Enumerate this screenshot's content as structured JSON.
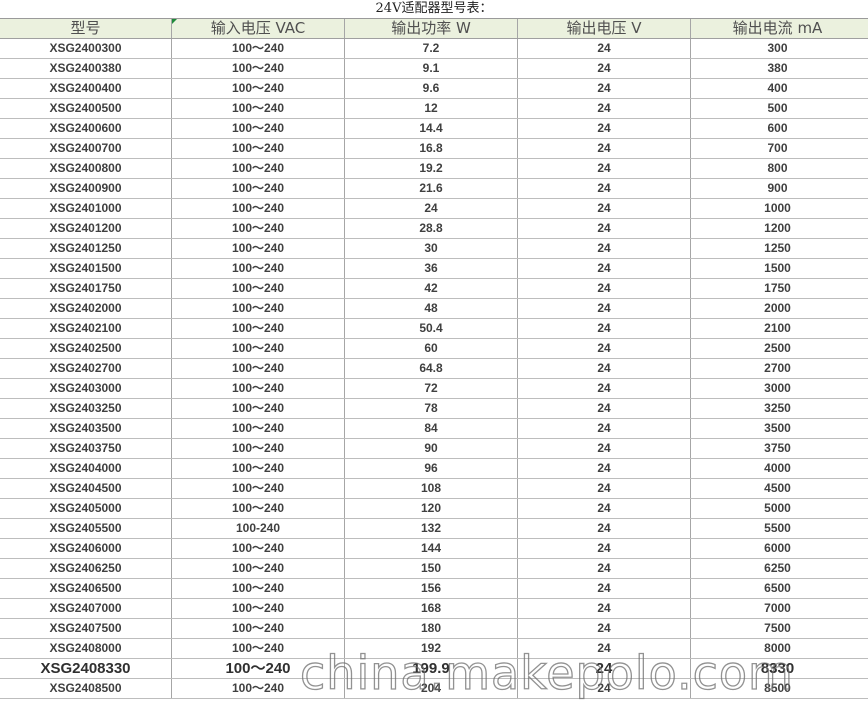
{
  "title": "24V适配器型号表：",
  "headers": [
    "型号",
    "输入电压 VAC",
    "输出功率 W",
    "输出电压 V",
    "输出电流 mA"
  ],
  "rows": [
    [
      "XSG2400300",
      "100～240",
      "7.2",
      "24",
      "300"
    ],
    [
      "XSG2400380",
      "100～240",
      "9.1",
      "24",
      "380"
    ],
    [
      "XSG2400400",
      "100～240",
      "9.6",
      "24",
      "400"
    ],
    [
      "XSG2400500",
      "100～240",
      "12",
      "24",
      "500"
    ],
    [
      "XSG2400600",
      "100～240",
      "14.4",
      "24",
      "600"
    ],
    [
      "XSG2400700",
      "100～240",
      "16.8",
      "24",
      "700"
    ],
    [
      "XSG2400800",
      "100～240",
      "19.2",
      "24",
      "800"
    ],
    [
      "XSG2400900",
      "100～240",
      "21.6",
      "24",
      "900"
    ],
    [
      "XSG2401000",
      "100～240",
      "24",
      "24",
      "1000"
    ],
    [
      "XSG2401200",
      "100～240",
      "28.8",
      "24",
      "1200"
    ],
    [
      "XSG2401250",
      "100～240",
      "30",
      "24",
      "1250"
    ],
    [
      "XSG2401500",
      "100～240",
      "36",
      "24",
      "1500"
    ],
    [
      "XSG2401750",
      "100～240",
      "42",
      "24",
      "1750"
    ],
    [
      "XSG2402000",
      "100～240",
      "48",
      "24",
      "2000"
    ],
    [
      "XSG2402100",
      "100～240",
      "50.4",
      "24",
      "2100"
    ],
    [
      "XSG2402500",
      "100～240",
      "60",
      "24",
      "2500"
    ],
    [
      "XSG2402700",
      "100～240",
      "64.8",
      "24",
      "2700"
    ],
    [
      "XSG2403000",
      "100～240",
      "72",
      "24",
      "3000"
    ],
    [
      "XSG2403250",
      "100～240",
      "78",
      "24",
      "3250"
    ],
    [
      "XSG2403500",
      "100～240",
      "84",
      "24",
      "3500"
    ],
    [
      "XSG2403750",
      "100～240",
      "90",
      "24",
      "3750"
    ],
    [
      "XSG2404000",
      "100～240",
      "96",
      "24",
      "4000"
    ],
    [
      "XSG2404500",
      "100～240",
      "108",
      "24",
      "4500"
    ],
    [
      "XSG2405000",
      "100～240",
      "120",
      "24",
      "5000"
    ],
    [
      "XSG2405500",
      "100-240",
      "132",
      "24",
      "5500"
    ],
    [
      "XSG2406000",
      "100～240",
      "144",
      "24",
      "6000"
    ],
    [
      "XSG2406250",
      "100～240",
      "150",
      "24",
      "6250"
    ],
    [
      "XSG2406500",
      "100～240",
      "156",
      "24",
      "6500"
    ],
    [
      "XSG2407000",
      "100～240",
      "168",
      "24",
      "7000"
    ],
    [
      "XSG2407500",
      "100～240",
      "180",
      "24",
      "7500"
    ],
    [
      "XSG2408000",
      "100～240",
      "192",
      "24",
      "8000"
    ],
    [
      "XSG2408330",
      "100～240",
      "199.9",
      "24",
      "8330"
    ],
    [
      "XSG2408500",
      "100～240",
      "204",
      "24",
      "8500"
    ]
  ],
  "emphasized_row": 31,
  "watermark": "china.makepolo.com"
}
